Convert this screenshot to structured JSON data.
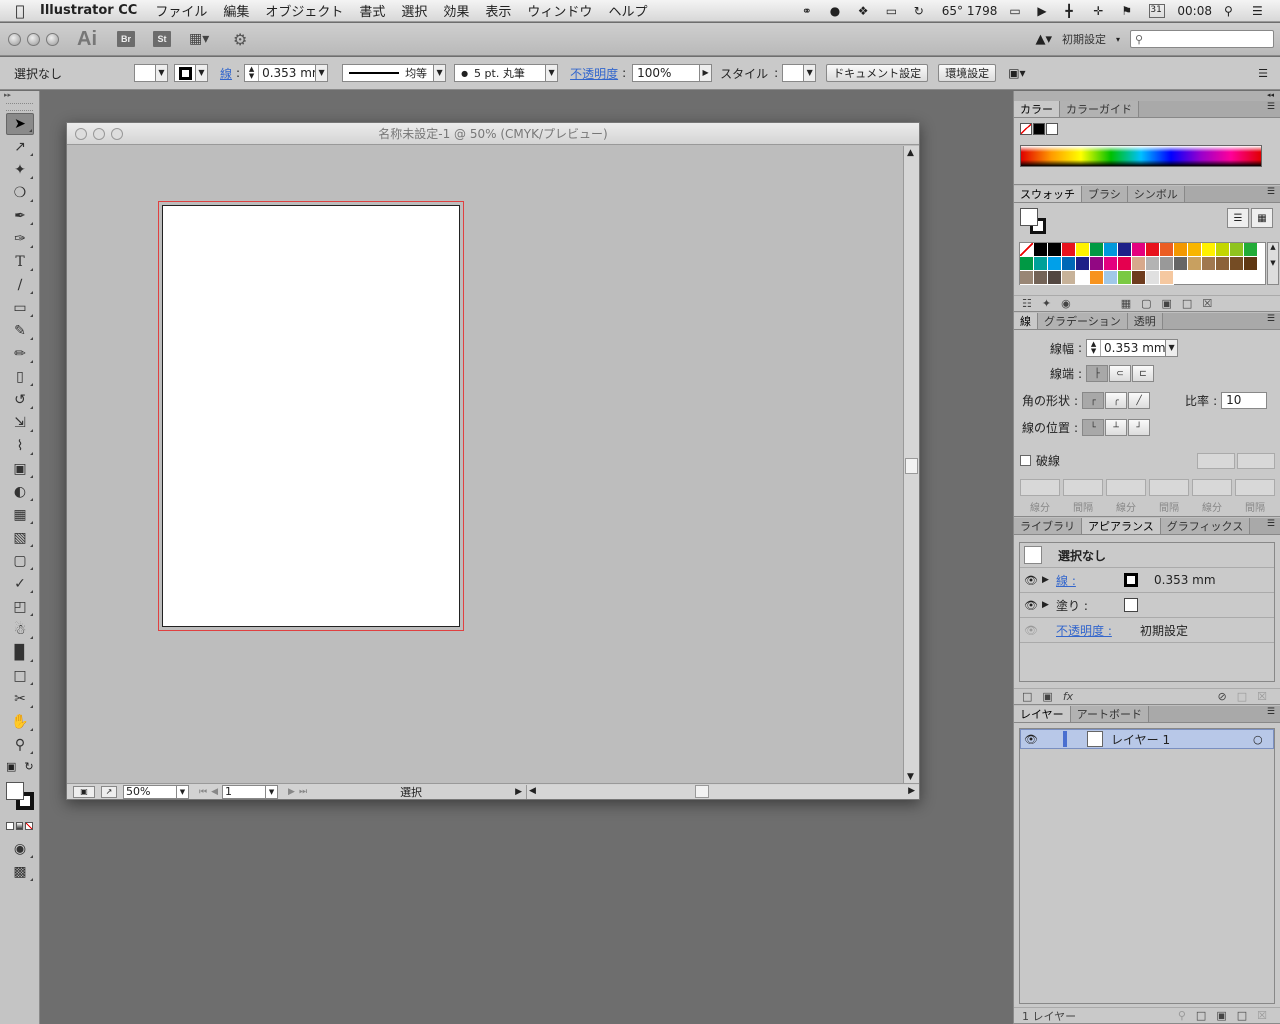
{
  "menubar": {
    "app_name": "Illustrator CC",
    "menus": [
      "ファイル",
      "編集",
      "オブジェクト",
      "書式",
      "選択",
      "効果",
      "表示",
      "ウィンドウ",
      "ヘルプ"
    ],
    "weather": "65° 1798",
    "clock": "00:08",
    "calendar_day": "31"
  },
  "appbar": {
    "logo": "Ai",
    "bridge": "Br",
    "stock": "St",
    "workspace": "初期設定",
    "search_placeholder": ""
  },
  "control": {
    "selection": "選択なし",
    "stroke_label": "線",
    "stroke_weight": "0.353 mm",
    "stroke_profile": "均等",
    "brush": "5 pt. 丸筆",
    "opacity_label": "不透明度",
    "opacity": "100%",
    "style_label": "スタイル",
    "doc_setup": "ドキュメント設定",
    "preferences": "環境設定"
  },
  "tools": {
    "items": [
      "selection-tool",
      "direct-selection-tool",
      "magic-wand-tool",
      "lasso-tool",
      "pen-tool",
      "curvature-tool",
      "type-tool",
      "line-tool",
      "rectangle-tool",
      "paintbrush-tool",
      "pencil-tool",
      "eraser-tool",
      "rotate-tool",
      "scale-tool",
      "width-tool",
      "free-transform-tool",
      "shape-builder-tool",
      "perspective-grid-tool",
      "mesh-tool",
      "gradient-tool",
      "eyedropper-tool",
      "blend-tool",
      "symbol-sprayer-tool",
      "column-graph-tool",
      "artboard-tool",
      "slice-tool",
      "hand-tool",
      "zoom-tool"
    ]
  },
  "document": {
    "title": "名称未設定-1 @ 50% (CMYK/プレビュー)",
    "zoom": "50%",
    "page": "1",
    "status": "選択"
  },
  "color_panel": {
    "tabs": [
      "カラー",
      "カラーガイド"
    ]
  },
  "swatches_panel": {
    "tabs": [
      "スウォッチ",
      "ブラシ",
      "シンボル"
    ],
    "colors": [
      "#ffffff",
      "#000000",
      "#000000",
      "#e8121d",
      "#fff200",
      "#009a44",
      "#0099dc",
      "#1d2088",
      "#e4007f",
      "#e8121d",
      "#eb5d23",
      "#f39800",
      "#f8b500",
      "#fff100",
      "#c3d600",
      "#8fc31f",
      "#22ac38",
      "#009944",
      "#00a199",
      "#00a0e9",
      "#0068b7",
      "#1d2088",
      "#920783",
      "#e4007f",
      "#e5004f",
      "#d7a98c",
      "#b3b3b3",
      "#999999",
      "#666666",
      "#c8a060",
      "#a07850",
      "#8c6239",
      "#754c24",
      "#603813",
      "#998675",
      "#736357",
      "#534741",
      "#c7b299",
      "#ffffff",
      "#f7931e",
      "#a0c8e8",
      "#7ac943",
      "#6e3c1e",
      "#e0e0e0",
      "#f5c8a0"
    ]
  },
  "stroke_panel": {
    "tabs": [
      "線",
      "グラデーション",
      "透明"
    ],
    "weight_label": "線幅",
    "weight": "0.353 mm",
    "cap_label": "線端",
    "corner_label": "角の形状",
    "limit_label": "比率",
    "limit": "10",
    "align_label": "線の位置",
    "dashed_label": "破線",
    "dash_labels": [
      "線分",
      "間隔",
      "線分",
      "間隔",
      "線分",
      "間隔"
    ]
  },
  "appearance_panel": {
    "tabs": [
      "ライブラリ",
      "アピアランス",
      "グラフィックス"
    ],
    "header": "選択なし",
    "stroke_label": "線",
    "stroke_value": "0.353 mm",
    "fill_label": "塗り",
    "opacity_label": "不透明度",
    "opacity_value": "初期設定"
  },
  "layers_panel": {
    "tabs": [
      "レイヤー",
      "アートボード"
    ],
    "layer_name": "レイヤー 1",
    "count": "1 レイヤー"
  }
}
